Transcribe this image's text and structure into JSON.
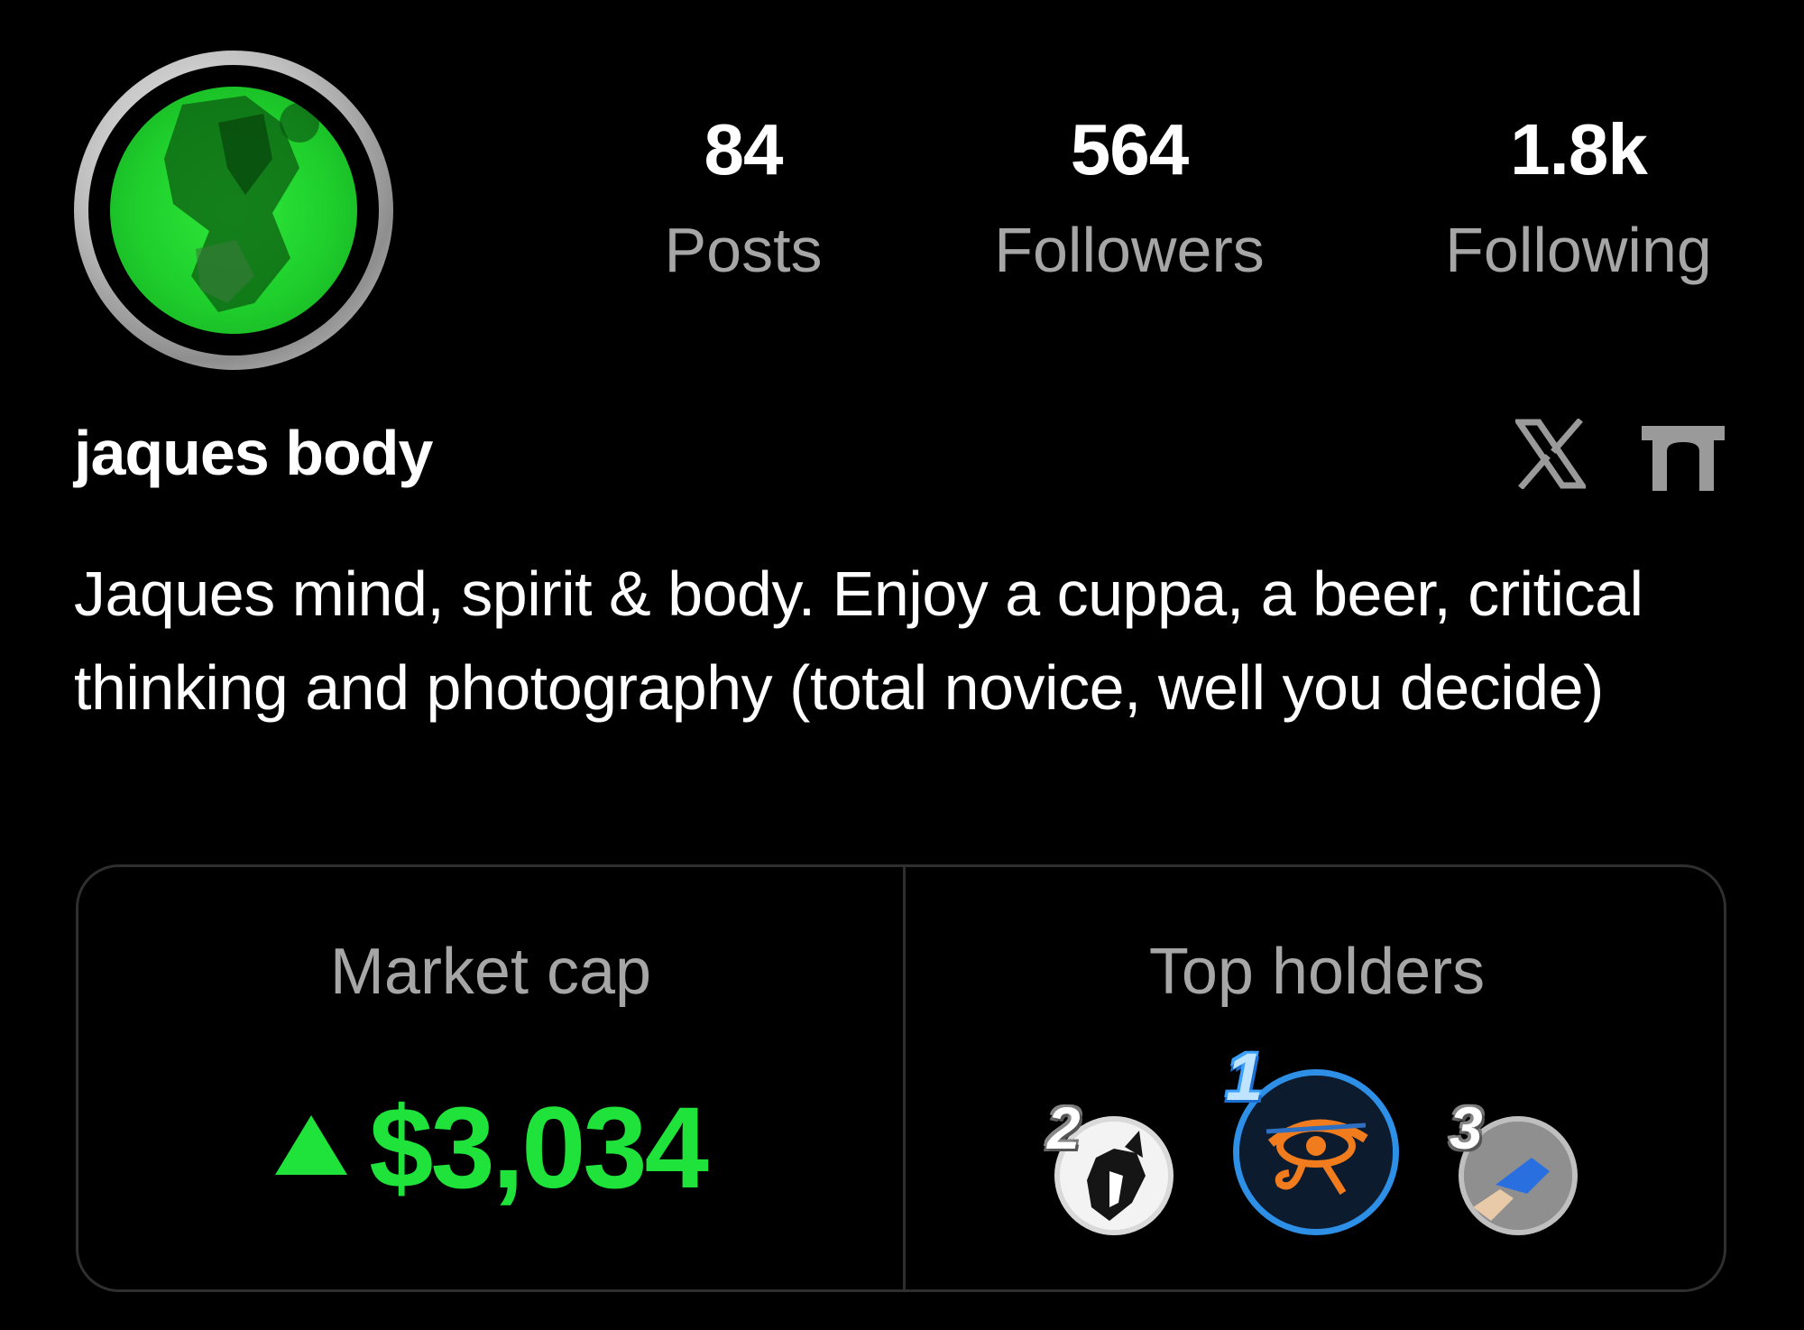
{
  "profile": {
    "display_name": "jaques body",
    "bio": "Jaques mind, spirit & body. Enjoy a cuppa, a beer, critical thinking and photography (total novice, well you decide)"
  },
  "stats": {
    "posts": {
      "value": "84",
      "label": "Posts"
    },
    "followers": {
      "value": "564",
      "label": "Followers"
    },
    "following": {
      "value": "1.8k",
      "label": "Following"
    }
  },
  "social_links": [
    {
      "name": "x-icon"
    },
    {
      "name": "gate-icon"
    }
  ],
  "market": {
    "title": "Market cap",
    "value": "$3,034",
    "trend": "up",
    "color": "#1fe23a"
  },
  "holders": {
    "title": "Top holders",
    "items": [
      {
        "rank": "2",
        "ring_color": "#d9d9d9"
      },
      {
        "rank": "1",
        "ring_color": "#2d8fe6"
      },
      {
        "rank": "3",
        "ring_color": "#bfbfbf"
      }
    ]
  },
  "colors": {
    "background": "#000000",
    "muted_text": "#a6a6a6",
    "accent_green": "#1fe23a",
    "border": "#2f2f2f"
  }
}
